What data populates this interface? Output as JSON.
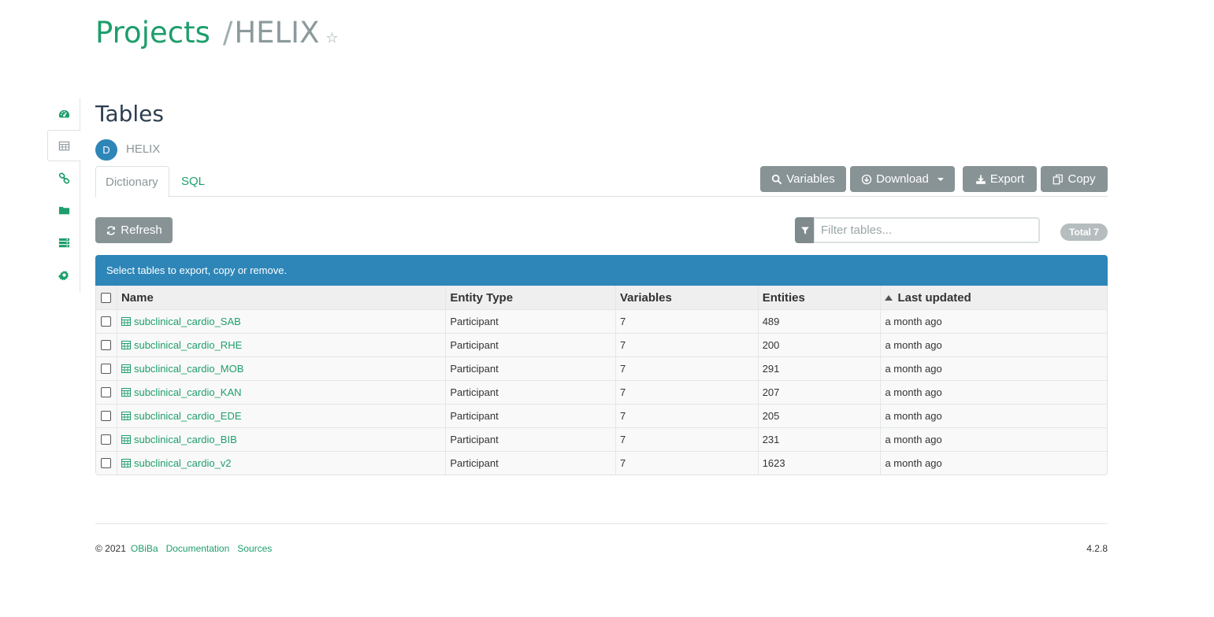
{
  "breadcrumb": {
    "root": "Projects",
    "separator": "/",
    "current": "HELIX"
  },
  "sidebar": {
    "items": [
      {
        "name": "dashboard-icon",
        "active": false
      },
      {
        "name": "tables-icon",
        "active": true
      },
      {
        "name": "link-icon",
        "active": false
      },
      {
        "name": "folder-icon",
        "active": false
      },
      {
        "name": "storage-icon",
        "active": false
      },
      {
        "name": "gear-icon",
        "active": false
      }
    ]
  },
  "page": {
    "title": "Tables",
    "datasource_badge": "D",
    "datasource_name": "HELIX"
  },
  "tabs": [
    {
      "label": "Dictionary"
    },
    {
      "label": "SQL"
    }
  ],
  "toolbar": {
    "variables_label": "Variables",
    "download_label": "Download",
    "export_label": "Export",
    "copy_label": "Copy",
    "refresh_label": "Refresh"
  },
  "filter": {
    "placeholder": "Filter tables...",
    "total_label": "Total 7"
  },
  "info_message": "Select tables to export, copy or remove.",
  "table": {
    "headers": [
      "Name",
      "Entity Type",
      "Variables",
      "Entities",
      "Last updated"
    ],
    "rows": [
      {
        "name": "subclinical_cardio_SAB",
        "entity_type": "Participant",
        "variables": "7",
        "entities": "489",
        "updated": "a month ago"
      },
      {
        "name": "subclinical_cardio_RHE",
        "entity_type": "Participant",
        "variables": "7",
        "entities": "200",
        "updated": "a month ago"
      },
      {
        "name": "subclinical_cardio_MOB",
        "entity_type": "Participant",
        "variables": "7",
        "entities": "291",
        "updated": "a month ago"
      },
      {
        "name": "subclinical_cardio_KAN",
        "entity_type": "Participant",
        "variables": "7",
        "entities": "207",
        "updated": "a month ago"
      },
      {
        "name": "subclinical_cardio_EDE",
        "entity_type": "Participant",
        "variables": "7",
        "entities": "205",
        "updated": "a month ago"
      },
      {
        "name": "subclinical_cardio_BIB",
        "entity_type": "Participant",
        "variables": "7",
        "entities": "231",
        "updated": "a month ago"
      },
      {
        "name": "subclinical_cardio_v2",
        "entity_type": "Participant",
        "variables": "7",
        "entities": "1623",
        "updated": "a month ago"
      }
    ]
  },
  "footer": {
    "copyright": "© 2021",
    "obiba": "OBiBa",
    "documentation": "Documentation",
    "sources": "Sources",
    "version": "4.2.8"
  },
  "colors": {
    "brand": "#1e9e6c",
    "info": "#2e86b8",
    "button": "#889396"
  }
}
